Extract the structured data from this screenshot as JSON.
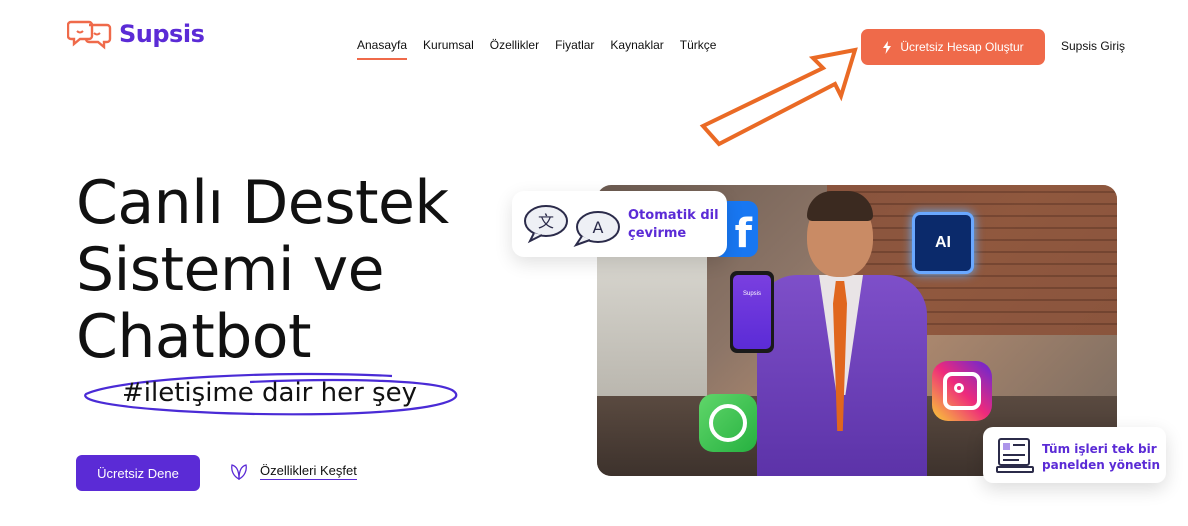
{
  "brand": {
    "name": "Supsis",
    "color": "#5b2bd6",
    "accent": "#ef6a4a"
  },
  "nav": {
    "items": [
      {
        "label": "Anasayfa",
        "active": true
      },
      {
        "label": "Kurumsal"
      },
      {
        "label": "Özellikler"
      },
      {
        "label": "Fiyatlar"
      },
      {
        "label": "Kaynaklar"
      },
      {
        "label": "Türkçe"
      }
    ]
  },
  "header": {
    "cta_label": "Ücretsiz Hesap Oluştur",
    "cta_icon": "lightning-bolt-icon",
    "login_label": "Supsis Giriş"
  },
  "hero": {
    "title": "Canlı Destek Sistemi ve Chatbot",
    "tagline": "#iletişime dair her şey",
    "try_label": "Ücretsiz Dene",
    "explore_label": "Özellikleri Keşfet",
    "phone_brand": "Supsis"
  },
  "callouts": {
    "translate": "Otomatik dil çevirme",
    "panel": "Tüm işleri tek bir panelden yönetin"
  },
  "badges": {
    "facebook": "f",
    "ai": "AI",
    "translate_left": "文",
    "translate_right": "A"
  }
}
